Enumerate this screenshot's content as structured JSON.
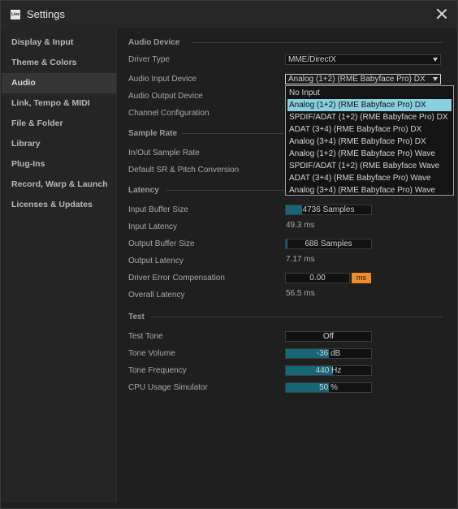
{
  "window": {
    "title": "Settings",
    "logo_text": "Live"
  },
  "sidebar": {
    "items": [
      {
        "label": "Display & Input"
      },
      {
        "label": "Theme & Colors"
      },
      {
        "label": "Audio"
      },
      {
        "label": "Link, Tempo & MIDI"
      },
      {
        "label": "File & Folder"
      },
      {
        "label": "Library"
      },
      {
        "label": "Plug-Ins"
      },
      {
        "label": "Record, Warp & Launch"
      },
      {
        "label": "Licenses & Updates"
      }
    ],
    "active": "Audio"
  },
  "audio_device": {
    "section": "Audio Device",
    "driver_type_label": "Driver Type",
    "driver_type_value": "MME/DirectX",
    "input_device_label": "Audio Input Device",
    "input_device_value": "Analog (1+2) (RME Babyface Pro) DX",
    "output_device_label": "Audio Output Device",
    "channel_config_label": "Channel Configuration"
  },
  "sample_rate": {
    "section": "Sample Rate",
    "io_label": "In/Out Sample Rate",
    "default_sr_label": "Default SR & Pitch Conversion"
  },
  "latency": {
    "section": "Latency",
    "input_buffer_label": "Input Buffer Size",
    "input_buffer_value": "4736 Samples",
    "input_buffer_fill": 0.19,
    "input_latency_label": "Input Latency",
    "input_latency_value": "49.3 ms",
    "output_buffer_label": "Output Buffer Size",
    "output_buffer_value": "688 Samples",
    "output_buffer_fill": 0.02,
    "output_latency_label": "Output Latency",
    "output_latency_value": "7.17 ms",
    "comp_label": "Driver Error Compensation",
    "comp_value": "0.00",
    "comp_unit": "ms",
    "overall_label": "Overall Latency",
    "overall_value": "56.5 ms"
  },
  "test": {
    "section": "Test",
    "tone_label": "Test Tone",
    "tone_value": "Off",
    "volume_label": "Tone Volume",
    "volume_value": "-36 dB",
    "volume_fill": 0.5,
    "freq_label": "Tone Frequency",
    "freq_value": "440 Hz",
    "freq_fill": 0.55,
    "cpu_label": "CPU Usage Simulator",
    "cpu_value": "50 %",
    "cpu_fill": 0.5
  },
  "dropdown_list": {
    "options": [
      "No Input",
      "Analog (1+2) (RME Babyface Pro) DX",
      "SPDIF/ADAT (1+2) (RME Babyface Pro) DX",
      "ADAT (3+4) (RME Babyface Pro) DX",
      "Analog (3+4) (RME Babyface Pro) DX",
      "Analog (1+2) (RME Babyface Pro) Wave",
      "SPDIF/ADAT (1+2) (RME Babyface  Wave",
      "ADAT (3+4) (RME Babyface Pro) Wave",
      "Analog (3+4) (RME Babyface Pro) Wave"
    ],
    "selected_index": 1
  },
  "colors": {
    "accent_fill": "#176677",
    "selection": "#89cfe0",
    "unit_button": "#f08c28"
  }
}
